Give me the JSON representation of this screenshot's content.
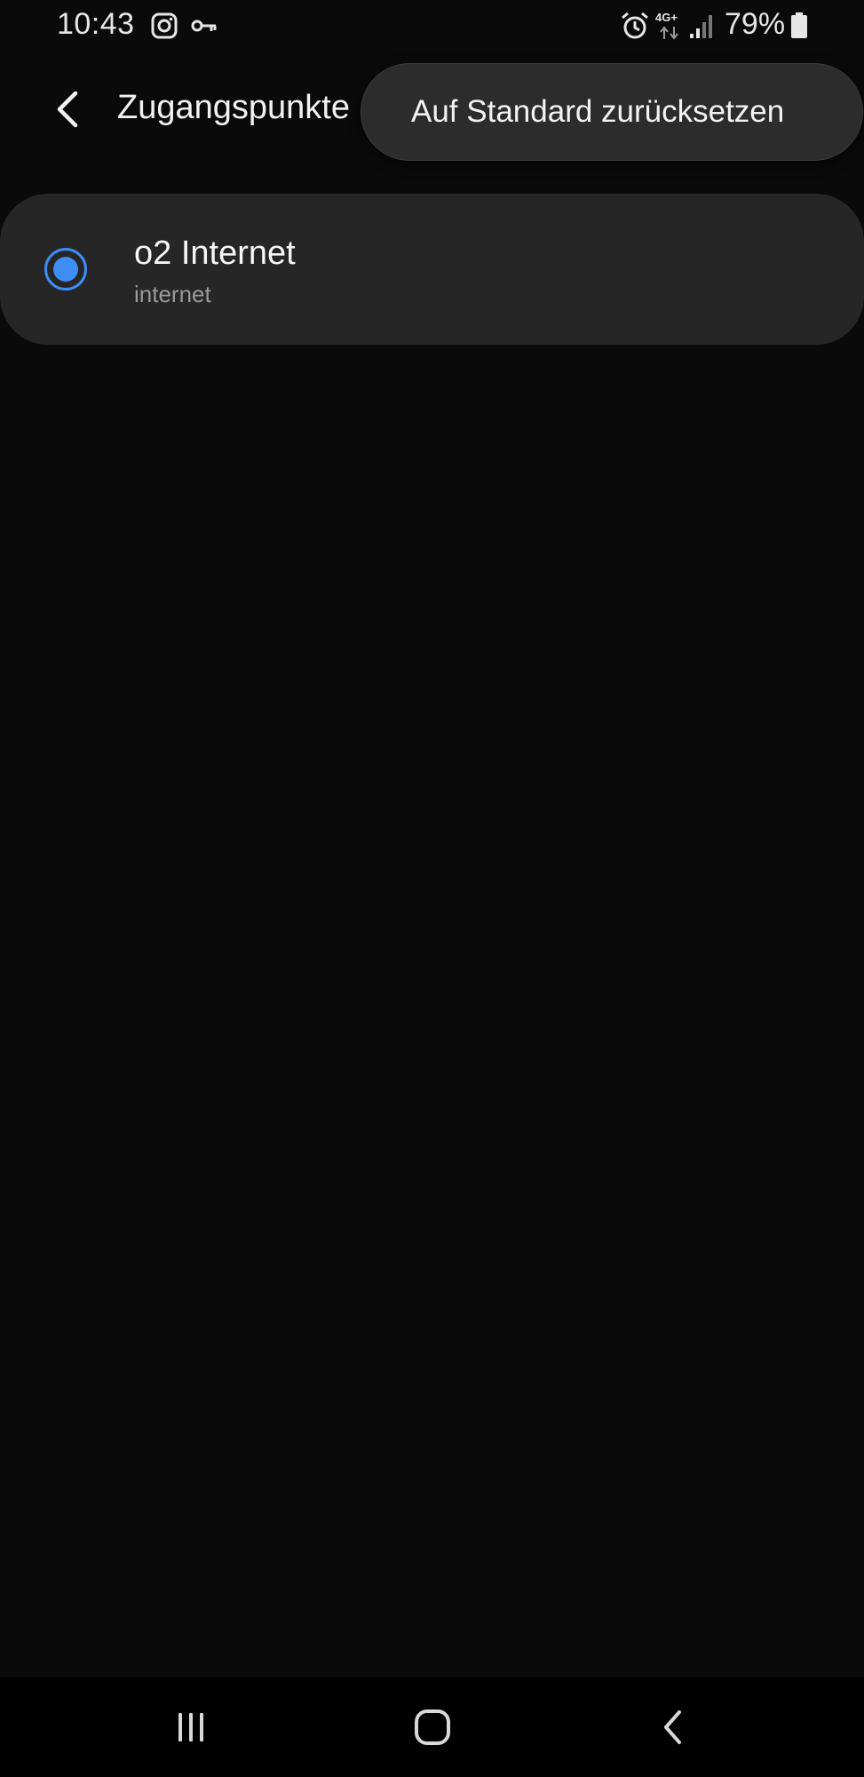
{
  "status_bar": {
    "time": "10:43",
    "network_type": "4G+",
    "battery_percent": "79%",
    "icons": [
      "instagram-icon",
      "vpn-key-icon",
      "alarm-icon",
      "network-4g-icon",
      "signal-icon",
      "battery-icon"
    ]
  },
  "app_bar": {
    "title": "Zugangspunkte",
    "back_icon": "chevron-left-icon"
  },
  "popup_menu": {
    "items": [
      {
        "label": "Auf Standard zurücksetzen"
      }
    ]
  },
  "apn_list": {
    "items": [
      {
        "name": "o2 Internet",
        "apn": "internet",
        "selected": true
      }
    ]
  },
  "nav_bar": {
    "buttons": [
      "recent-apps-icon",
      "home-icon",
      "back-icon"
    ]
  },
  "colors": {
    "background": "#0a0a0a",
    "card": "#262626",
    "popup": "#2c2c2c",
    "accent": "#3d8ef5"
  }
}
